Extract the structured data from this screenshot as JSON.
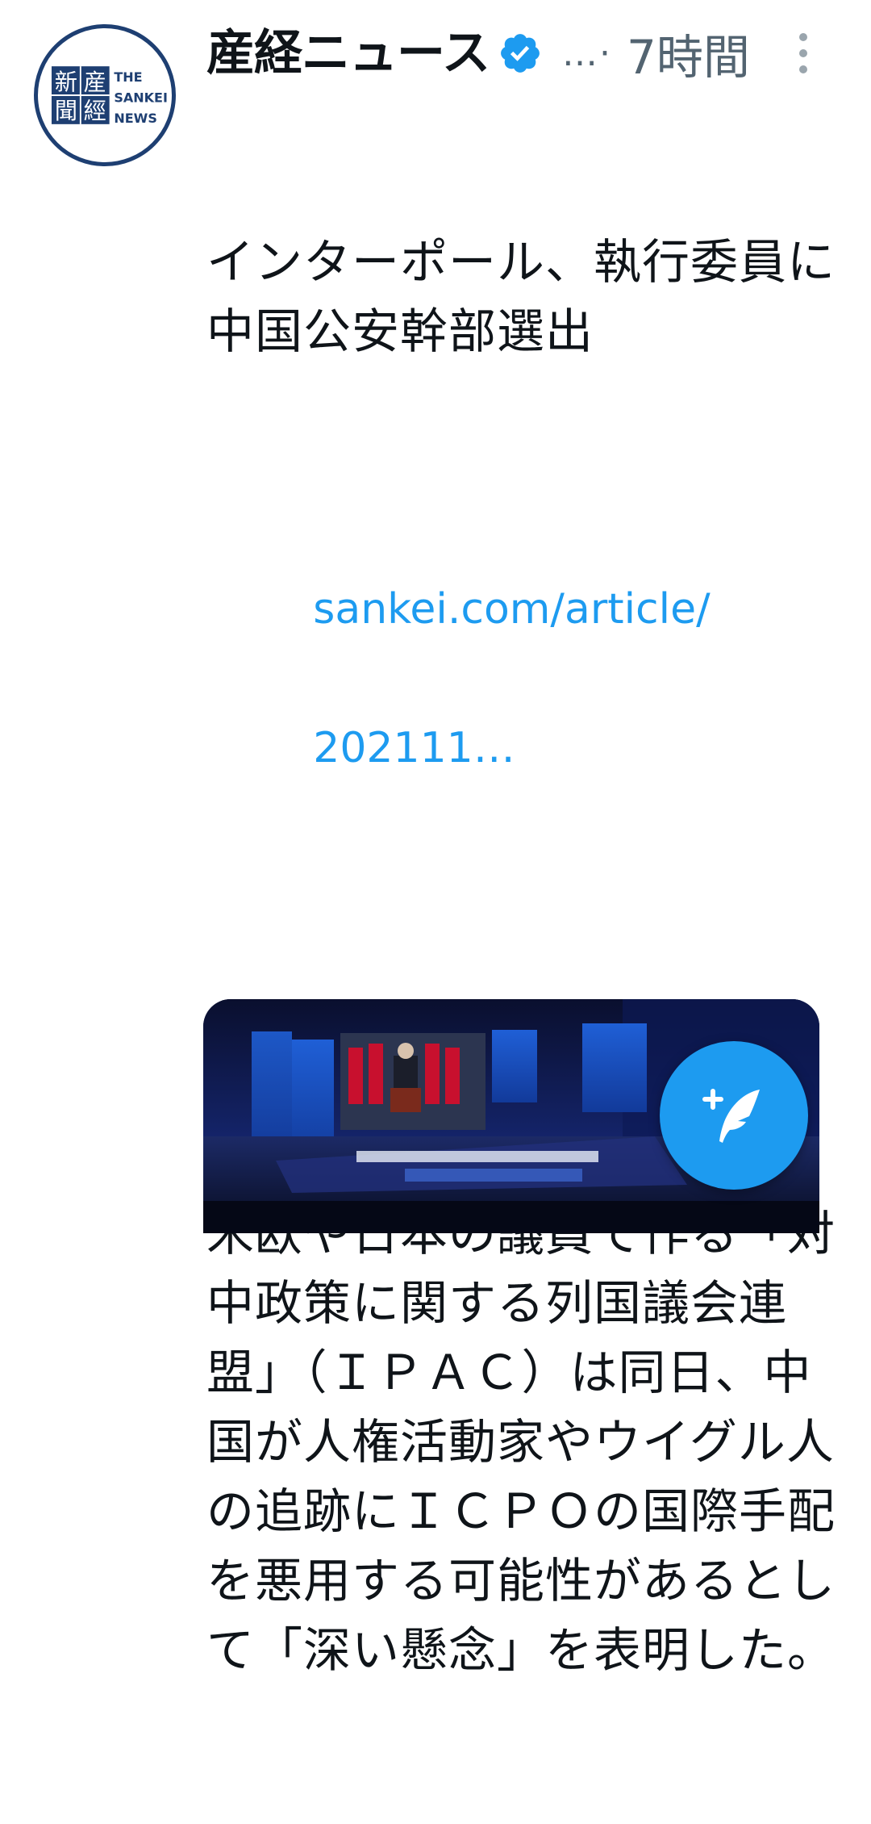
{
  "account": {
    "display_name": "産経ニュース",
    "handle": "…·",
    "time": "7時間",
    "avatar_text": {
      "kanji": [
        "新",
        "産",
        "聞",
        "經"
      ],
      "english": [
        "THE",
        "SANKEI",
        "NEWS"
      ]
    }
  },
  "tweet": {
    "headline": "インターポール、執行委員に中国公安幹部選出",
    "link": [
      "sankei.com/article/",
      "202111…"
    ],
    "body": "米欧や日本の議員で作る「対中政策に関する列国議会連盟」（ＩＰＡＣ）は同日、中国が人権活動家やウイグル人の追跡にＩＣＰＯの国際手配を悪用する可能性があるとして「深い懸念」を表明した。"
  },
  "colors": {
    "accent": "#1d9bf0",
    "secondary_text": "#536471",
    "avatar_border": "#1e3f72"
  },
  "icons": {
    "verified": "verified-badge-icon",
    "more": "more-vertical-icon",
    "compose": "compose-tweet-icon"
  }
}
